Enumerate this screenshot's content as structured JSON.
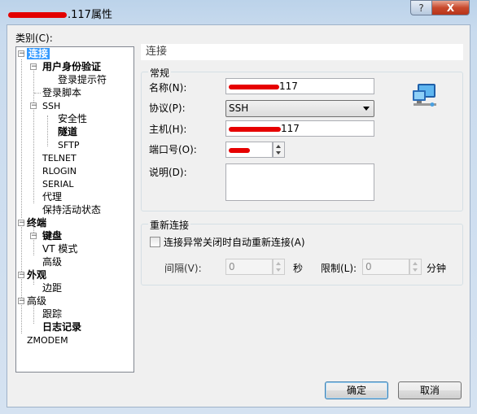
{
  "window": {
    "title": ".117属性",
    "help_glyph": "?",
    "close_glyph": "X"
  },
  "category_label": "类别(C):",
  "tree": {
    "connection": "连接",
    "auth": "用户身份验证",
    "login_prompt": "登录提示符",
    "login_script": "登录脚本",
    "ssh": "SSH",
    "security": "安全性",
    "tunnel": "隧道",
    "sftp": "SFTP",
    "telnet": "TELNET",
    "rlogin": "RLOGIN",
    "serial": "SERIAL",
    "proxy": "代理",
    "keepalive": "保持活动状态",
    "terminal": "终端",
    "keyboard": "键盘",
    "vt_mode": "VT 模式",
    "advanced_term": "高级",
    "appearance": "外观",
    "border": "边距",
    "advanced": "高级",
    "trace": "跟踪",
    "log": "日志记录",
    "zmodem": "ZMODEM"
  },
  "panel": {
    "header": "连接",
    "general": {
      "title": "常规",
      "name_label": "名称(N):",
      "name_value": "117",
      "protocol_label": "协议(P):",
      "protocol_value": "SSH",
      "host_label": "主机(H):",
      "host_value": "117",
      "port_label": "端口号(O):",
      "desc_label": "说明(D):"
    },
    "reconnect": {
      "title": "重新连接",
      "checkbox_label": "连接异常关闭时自动重新连接(A)",
      "interval_label": "间隔(V):",
      "interval_value": "0",
      "interval_unit": "秒",
      "limit_label": "限制(L):",
      "limit_value": "0",
      "limit_unit": "分钟"
    }
  },
  "buttons": {
    "ok": "确定",
    "cancel": "取消"
  }
}
